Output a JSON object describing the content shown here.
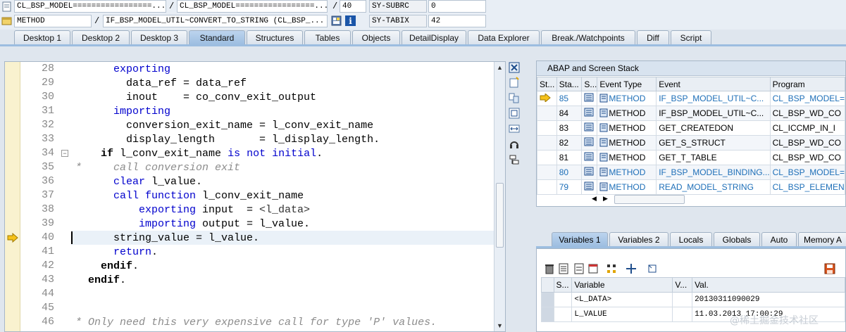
{
  "header": {
    "row1": {
      "program1": "CL_BSP_MODEL=================...",
      "program2": "CL_BSP_MODEL=================...",
      "line": "40",
      "sysfield": "SY-SUBRC",
      "sysvalue": "0"
    },
    "row2": {
      "event_type": "METHOD",
      "event": "IF_BSP_MODEL_UTIL~CONVERT_TO_STRING (CL_BSP_...",
      "sysfield": "SY-TABIX",
      "sysvalue": "42"
    },
    "separator": "/"
  },
  "tabs": [
    "Desktop 1",
    "Desktop 2",
    "Desktop 3",
    "Standard",
    "Structures",
    "Tables",
    "Objects",
    "DetailDisplay",
    "Data Explorer",
    "Break./Watchpoints",
    "Diff",
    "Script"
  ],
  "active_tab": "Standard",
  "editor": {
    "lines": [
      {
        "num": "28",
        "code": "      exporting"
      },
      {
        "num": "29",
        "code": "        data_ref = data_ref"
      },
      {
        "num": "30",
        "code": "        inout    = co_conv_exit_output"
      },
      {
        "num": "31",
        "code": "      importing"
      },
      {
        "num": "32",
        "code": "        conversion_exit_name = l_conv_exit_name"
      },
      {
        "num": "33",
        "code": "        display_length       = l_display_length."
      },
      {
        "num": "34",
        "code": "    if l_conv_exit_name is not initial."
      },
      {
        "num": "35",
        "code": "*     call conversion exit"
      },
      {
        "num": "36",
        "code": "      clear l_value."
      },
      {
        "num": "37",
        "code": "      call function l_conv_exit_name"
      },
      {
        "num": "38",
        "code": "          exporting input  = <l_data>"
      },
      {
        "num": "39",
        "code": "          importing output = l_value."
      },
      {
        "num": "40",
        "code": "      string_value = l_value."
      },
      {
        "num": "41",
        "code": "      return."
      },
      {
        "num": "42",
        "code": "    endif."
      },
      {
        "num": "43",
        "code": "  endif."
      },
      {
        "num": "44",
        "code": ""
      },
      {
        "num": "45",
        "code": ""
      },
      {
        "num": "46",
        "code": "* Only need this very expensive call for type 'P' values."
      }
    ]
  },
  "stack": {
    "title": "ABAP and Screen Stack",
    "columns": [
      "St...",
      "Sta...",
      "S...",
      "Event Type",
      "Event",
      "Program"
    ],
    "rows": [
      {
        "level": "85",
        "type": "METHOD",
        "event": "IF_BSP_MODEL_UTIL~C...",
        "program": "CL_BSP_MODEL=",
        "blue": true,
        "current": true
      },
      {
        "level": "84",
        "type": "METHOD",
        "event": "IF_BSP_MODEL_UTIL~C...",
        "program": "CL_BSP_WD_CO",
        "blue": false,
        "current": false
      },
      {
        "level": "83",
        "type": "METHOD",
        "event": "GET_CREATEDON",
        "program": "CL_ICCMP_IN_I",
        "blue": false,
        "current": false
      },
      {
        "level": "82",
        "type": "METHOD",
        "event": "GET_S_STRUCT",
        "program": "CL_BSP_WD_CO",
        "blue": false,
        "current": false
      },
      {
        "level": "81",
        "type": "METHOD",
        "event": "GET_T_TABLE",
        "program": "CL_BSP_WD_CO",
        "blue": false,
        "current": false
      },
      {
        "level": "80",
        "type": "METHOD",
        "event": "IF_BSP_MODEL_BINDING...",
        "program": "CL_BSP_MODEL=",
        "blue": true,
        "current": false
      },
      {
        "level": "79",
        "type": "METHOD",
        "event": "READ_MODEL_STRING",
        "program": "CL_BSP_ELEMEN",
        "blue": true,
        "current": false
      }
    ]
  },
  "var_tabs": [
    "Variables 1",
    "Variables 2",
    "Locals",
    "Globals",
    "Auto",
    "Memory A"
  ],
  "active_var_tab": "Variables 1",
  "variables": {
    "columns": [
      "S...",
      "Variable",
      "V...",
      "Val."
    ],
    "rows": [
      {
        "name": "<L_DATA>",
        "value": "20130311090029"
      },
      {
        "name": "L_VALUE",
        "value": "11.03.2013 17:00:29"
      }
    ]
  },
  "watermark": "@稀土掘金技术社区",
  "icons": {
    "current_line": "arrow-right-icon",
    "method": "method-icon"
  }
}
